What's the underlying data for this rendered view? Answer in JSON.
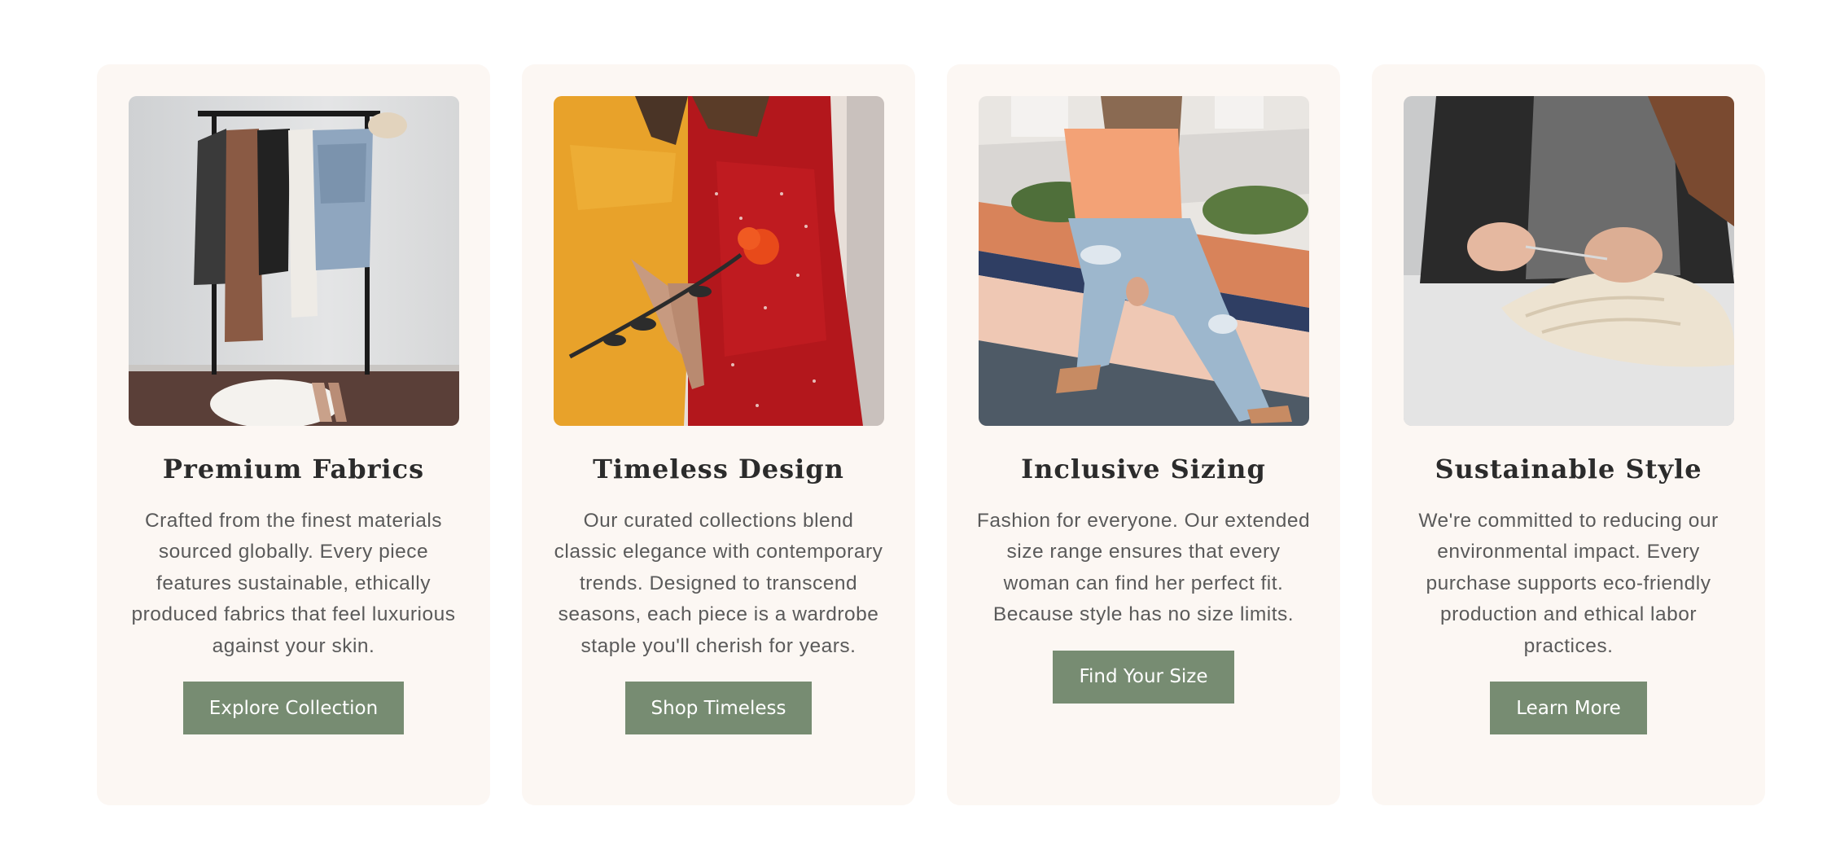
{
  "cards": [
    {
      "image_icon": "clothing-rack-photo",
      "title": "Premium Fabrics",
      "description": "Crafted from the finest materials sourced globally. Every piece features sustainable, ethically produced fabrics that feel luxurious against your skin.",
      "button_label": "Explore Collection"
    },
    {
      "image_icon": "dresses-photo",
      "title": "Timeless Design",
      "description": "Our curated collections blend classic elegance with contemporary trends. Designed to transcend seasons, each piece is a wardrobe staple you'll cherish for years.",
      "button_label": "Shop Timeless"
    },
    {
      "image_icon": "woman-in-jeans-photo",
      "title": "Inclusive Sizing",
      "description": "Fashion for everyone. Our extended size range ensures that every woman can find her perfect fit. Because style has no size limits.",
      "button_label": "Find Your Size"
    },
    {
      "image_icon": "knitting-photo",
      "title": "Sustainable Style",
      "description": "We're committed to reducing our environmental impact. Every purchase supports eco-friendly production and ethical labor practices.",
      "button_label": "Learn More"
    }
  ],
  "colors": {
    "card_background": "#fcf7f3",
    "button_background": "#778c72",
    "title_text": "#2b2b2b",
    "body_text": "#5a5a5a"
  }
}
